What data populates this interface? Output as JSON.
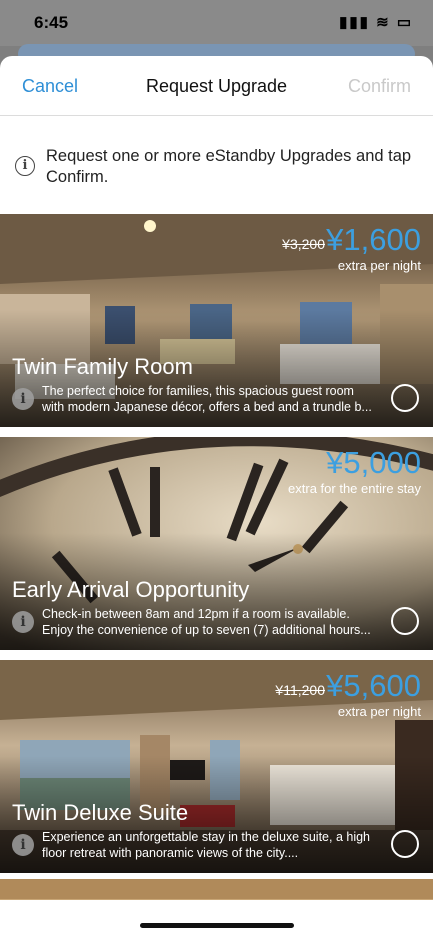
{
  "status_bar": {
    "time": "6:45",
    "icons": "▮▮▮ ≋ ▭"
  },
  "nav": {
    "cancel_label": "Cancel",
    "title": "Request Upgrade",
    "confirm_label": "Confirm"
  },
  "info": {
    "text": "Request one or more eStandby Upgrades and tap Confirm."
  },
  "cards": [
    {
      "old_price": "¥3,200",
      "price": "¥1,600",
      "price_note": "extra per night",
      "title": "Twin Family Room",
      "desc_line1": "The perfect choice for families, this spacious guest room",
      "desc_line2": "with modern Japanese décor, offers a bed and a trundle b..."
    },
    {
      "old_price": "",
      "price": "¥5,000",
      "price_note": "extra for the entire stay",
      "title": "Early Arrival Opportunity",
      "desc_line1": "Check-in between 8am and 12pm if a room is available.",
      "desc_line2": "Enjoy the convenience of up to seven (7) additional hours..."
    },
    {
      "old_price": "¥11,200",
      "price": "¥5,600",
      "price_note": "extra per night",
      "title": "Twin Deluxe Suite",
      "desc_line1": "Experience an unforgettable stay in the deluxe suite, a high",
      "desc_line2": "floor retreat with panoramic views of the city...."
    }
  ],
  "colors": {
    "accent": "#3c9fe0",
    "link": "#2f8fd6",
    "disabled": "#c9c9c9"
  }
}
